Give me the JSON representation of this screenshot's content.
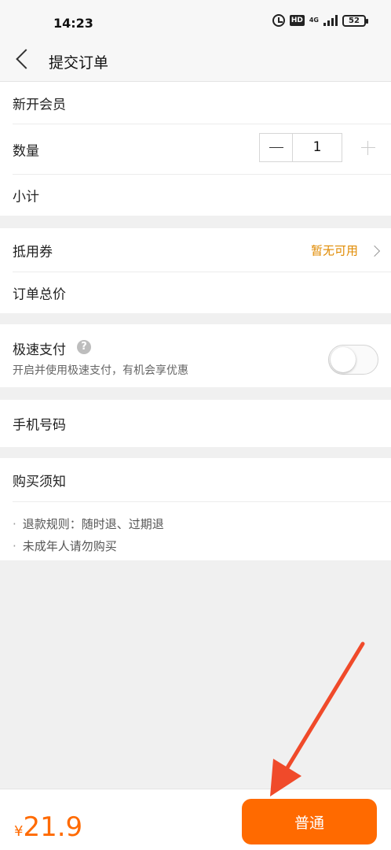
{
  "status_bar": {
    "time": "14:23",
    "icons": [
      "alarm-icon",
      "hd-icon",
      "4g-icon",
      "signal-icon",
      "battery-icon"
    ],
    "hd": "HD",
    "network": "4G",
    "battery": "52"
  },
  "header": {
    "title": "提交订单",
    "back_icon": "back-icon"
  },
  "order": {
    "membership": "新开会员",
    "quantity_label": "数量",
    "quantity_value": "1",
    "subtotal_label": "小计"
  },
  "pricing": {
    "coupon_label": "抵用券",
    "coupon_status": "暂无可用",
    "total_label": "订单总价"
  },
  "fast_pay": {
    "title": "极速支付",
    "help_icon": "?",
    "subtitle": "开启并使用极速支付，有机会享优惠",
    "enabled": false
  },
  "phone": {
    "label": "手机号码"
  },
  "notice": {
    "title": "购买须知",
    "items": [
      "退款规则：随时退、过期退",
      "未成年人请勿购买"
    ]
  },
  "footer": {
    "currency": "¥",
    "price": "21.9",
    "submit_label": "普通"
  },
  "colors": {
    "accent": "#ff6a00",
    "coupon": "#e08a00",
    "annotation_arrow": "#f04a2a"
  }
}
